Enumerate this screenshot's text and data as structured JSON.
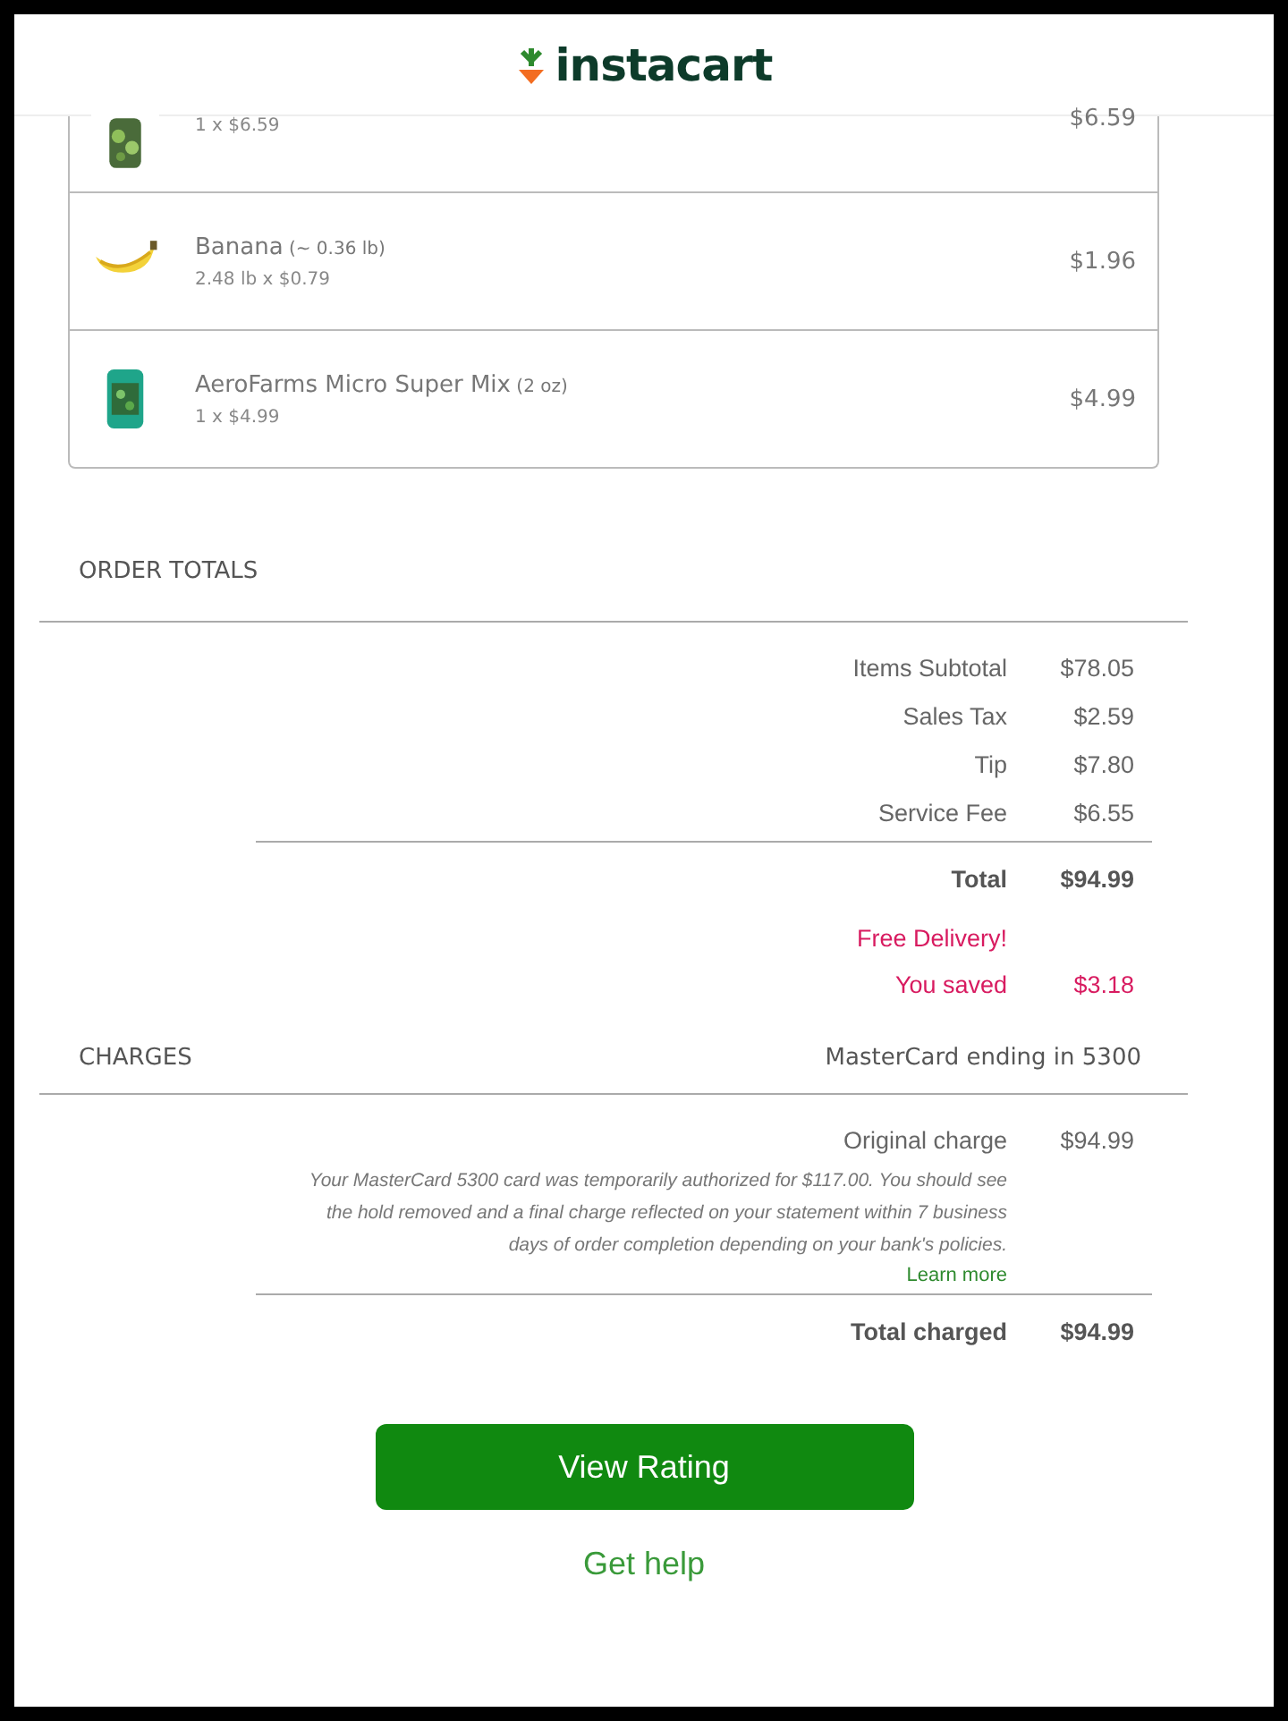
{
  "header": {
    "logo": "instacart"
  },
  "items": [
    {
      "qty": "1 x $6.59",
      "price": "$6.59",
      "kind": "greens"
    },
    {
      "name": "Banana",
      "size": "(~ 0.36 lb)",
      "qty": "2.48 lb x $0.79",
      "price": "$1.96",
      "kind": "banana"
    },
    {
      "name": "AeroFarms Micro Super Mix",
      "size": "(2 oz)",
      "qty": "1 x $4.99",
      "price": "$4.99",
      "kind": "box"
    }
  ],
  "order_totals": {
    "title": "ORDER TOTALS",
    "lines": [
      {
        "kind": "regular",
        "label": "Items Subtotal",
        "value": "$78.05"
      },
      {
        "kind": "regular",
        "label": "Sales Tax",
        "value": "$2.59"
      },
      {
        "kind": "regular",
        "label": "Tip",
        "value": "$7.80"
      },
      {
        "kind": "regular",
        "label": "Service Fee",
        "value": "$6.55"
      },
      {
        "kind": "total",
        "label": "Total",
        "value": "$94.99"
      },
      {
        "kind": "promo",
        "label": "Free Delivery!"
      },
      {
        "kind": "promo",
        "label": "You saved",
        "value": "$3.18"
      }
    ]
  },
  "charges": {
    "title": "CHARGES",
    "card": "MasterCard ending in 5300",
    "lines": [
      {
        "kind": "regular",
        "label": "Original charge",
        "value": "$94.99"
      },
      {
        "kind": "note",
        "text": "Your MasterCard 5300 card was temporarily authorized for $117.00. You should see the hold removed and a final charge reflected on your statement within 7 business days of order completion depending on your bank's policies.",
        "link": "Learn more"
      },
      {
        "kind": "total",
        "label": "Total charged",
        "value": "$94.99"
      }
    ]
  },
  "actions": {
    "primary": "View Rating",
    "secondary": "Get help"
  }
}
